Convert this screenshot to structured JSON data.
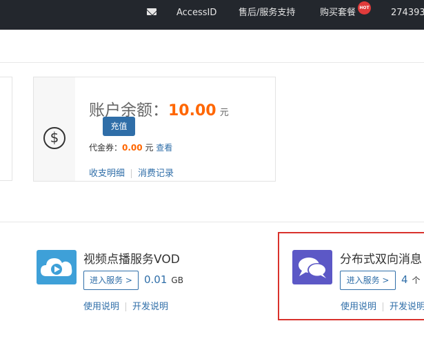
{
  "topbar": {
    "mail_icon": "mail-icon",
    "access_id": "AccessID",
    "support": "售后/服务支持",
    "buy_package": "购买套餐",
    "hot_badge": "HOT",
    "account": "274393"
  },
  "balance": {
    "icon": "dollar-icon",
    "label": "账户余额：",
    "amount": "10.00",
    "unit": "元",
    "recharge_button": "充值",
    "voucher_label": "代金券：",
    "voucher_amount": "0.00",
    "voucher_unit": "元",
    "voucher_view": "查看",
    "income_expense": "收支明细",
    "consumption_records": "消费记录"
  },
  "services": [
    {
      "icon": "cloud-play-icon",
      "title": "视频点播服务VOD",
      "enter_button": "进入服务 >",
      "amount": "0.01",
      "unit": "GB",
      "usage_guide": "使用说明",
      "dev_guide": "开发说明"
    },
    {
      "icon": "chat-bubbles-icon",
      "title": "分布式双向消息",
      "enter_button": "进入服务 >",
      "amount": "4",
      "unit": "个",
      "usage_guide": "使用说明",
      "dev_guide": "开发说明"
    }
  ],
  "colors": {
    "topbar_bg": "#23272d",
    "accent": "#2f6ea8",
    "amount_orange": "#ff6600",
    "highlight_red": "#d9312b",
    "vod_icon_bg": "#3ea0d8",
    "msg_icon_bg": "#5c58c6"
  }
}
